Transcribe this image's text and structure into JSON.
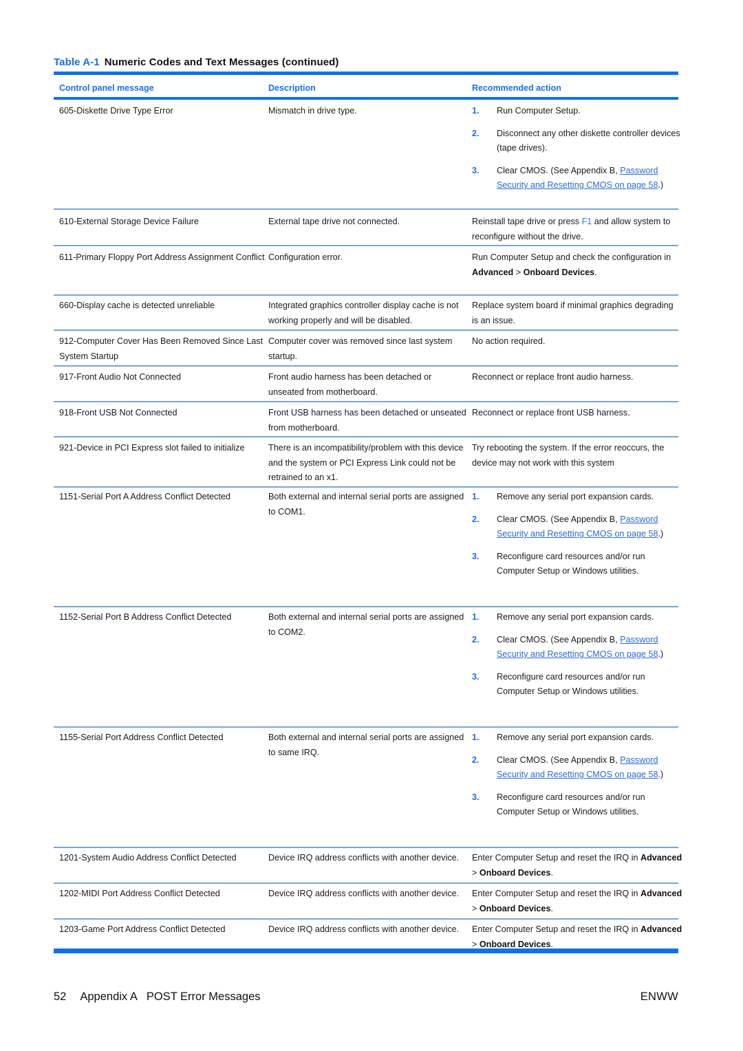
{
  "table": {
    "caption_label": "Table A-1",
    "caption_text": "Numeric Codes and Text Messages (continued)",
    "headers": {
      "col1": "Control panel message",
      "col2": "Description",
      "col3": "Recommended action"
    },
    "rows": [
      {
        "message": "605-Diskette Drive Type Error",
        "description": "Mismatch in drive type.",
        "actions": [
          {
            "num": "1.",
            "text": "Run Computer Setup."
          },
          {
            "num": "2.",
            "text": "Disconnect any other diskette controller devices (tape drives)."
          },
          {
            "num": "3.",
            "lead": "Clear CMOS. (See Appendix B, ",
            "link": "Password Security and Resetting CMOS on page 58",
            "tail": ".)"
          }
        ]
      },
      {
        "message": "610-External Storage Device Failure",
        "description": "External tape drive not connected.",
        "action_lead": "Reinstall tape drive or press ",
        "action_key": "F1",
        "action_tail": " and allow system to reconfigure without the drive."
      },
      {
        "message": "611-Primary Floppy Port Address Assignment Conflict",
        "description": "Configuration error.",
        "action_lead": "Run Computer Setup and check the configuration in ",
        "action_bold1": "Advanced",
        "action_mid": " > ",
        "action_bold2": "Onboard Devices",
        "action_tail": "."
      },
      {
        "message": "660-Display cache is detected unreliable",
        "description": "Integrated graphics controller display cache is not working properly and will be disabled.",
        "action": "Replace system board if minimal graphics degrading is an issue."
      },
      {
        "message": "912-Computer Cover Has Been Removed Since Last System Startup",
        "description": "Computer cover was removed since last system startup.",
        "action": "No action required."
      },
      {
        "message": "917-Front Audio Not Connected",
        "description": "Front audio harness has been detached or unseated from motherboard.",
        "action": "Reconnect or replace front audio harness."
      },
      {
        "message": "918-Front USB Not Connected",
        "description": "Front USB harness has been detached or unseated from motherboard.",
        "action": "Reconnect or replace front USB harness."
      },
      {
        "message": "921-Device in PCI Express slot failed to initialize",
        "description": "There is an incompatibility/problem with this device and the system or PCI Express Link could not be retrained to an x1.",
        "action": "Try rebooting the system. If the error reoccurs, the device may not work with this system"
      },
      {
        "message": "1151-Serial Port A Address Conflict Detected",
        "description": "Both external and internal serial ports are assigned to COM1.",
        "actions": [
          {
            "num": "1.",
            "text": "Remove any serial port expansion cards."
          },
          {
            "num": "2.",
            "lead": "Clear CMOS. (See Appendix B, ",
            "link": "Password Security and Resetting CMOS on page 58",
            "tail": ".)"
          },
          {
            "num": "3.",
            "text": "Reconfigure card resources and/or run Computer Setup or Windows utilities."
          }
        ]
      },
      {
        "message": "1152-Serial Port B Address Conflict Detected",
        "description": "Both external and internal serial ports are assigned to COM2.",
        "actions": [
          {
            "num": "1.",
            "text": "Remove any serial port expansion cards."
          },
          {
            "num": "2.",
            "lead": "Clear CMOS. (See Appendix B, ",
            "link": "Password Security and Resetting CMOS on page 58",
            "tail": ".)"
          },
          {
            "num": "3.",
            "text": "Reconfigure card resources and/or run Computer Setup or Windows utilities."
          }
        ]
      },
      {
        "message": "1155-Serial Port Address Conflict Detected",
        "description": "Both external and internal serial ports are assigned to same IRQ.",
        "actions": [
          {
            "num": "1.",
            "text": "Remove any serial port expansion cards."
          },
          {
            "num": "2.",
            "lead": "Clear CMOS. (See Appendix B, ",
            "link": "Password Security and Resetting CMOS on page 58",
            "tail": ".)"
          },
          {
            "num": "3.",
            "text": "Reconfigure card resources and/or run Computer Setup or Windows utilities."
          }
        ]
      },
      {
        "message": "1201-System Audio Address Conflict Detected",
        "description": "Device IRQ address conflicts with another device.",
        "action_lead": "Enter Computer Setup and reset the IRQ in ",
        "action_bold1": "Advanced",
        "action_mid": " > ",
        "action_bold2": "Onboard Devices",
        "action_tail": "."
      },
      {
        "message": "1202-MIDI Port Address Conflict Detected",
        "description": "Device IRQ address conflicts with another device.",
        "action_lead": "Enter Computer Setup and reset the IRQ in ",
        "action_bold1": "Advanced",
        "action_mid": " > ",
        "action_bold2": "Onboard Devices",
        "action_tail": "."
      },
      {
        "message": "1203-Game Port Address Conflict Detected",
        "description": "Device IRQ address conflicts with another device.",
        "action_lead": "Enter Computer Setup and reset the IRQ in ",
        "action_bold1": "Advanced",
        "action_mid": " > ",
        "action_bold2": "Onboard Devices",
        "action_tail": "."
      }
    ]
  },
  "footer": {
    "page_number": "52",
    "appendix": "Appendix A",
    "section_title": "POST Error Messages",
    "brand": "ENWW"
  },
  "colors": {
    "heading_blue": "#1a6ef5",
    "rule_blue": "#0f6ff0",
    "row_rule_blue": "#7ba4d9",
    "link_blue": "#2a6ad8",
    "key_blue": "#2a7ef0",
    "text": "#1a1a1a"
  }
}
